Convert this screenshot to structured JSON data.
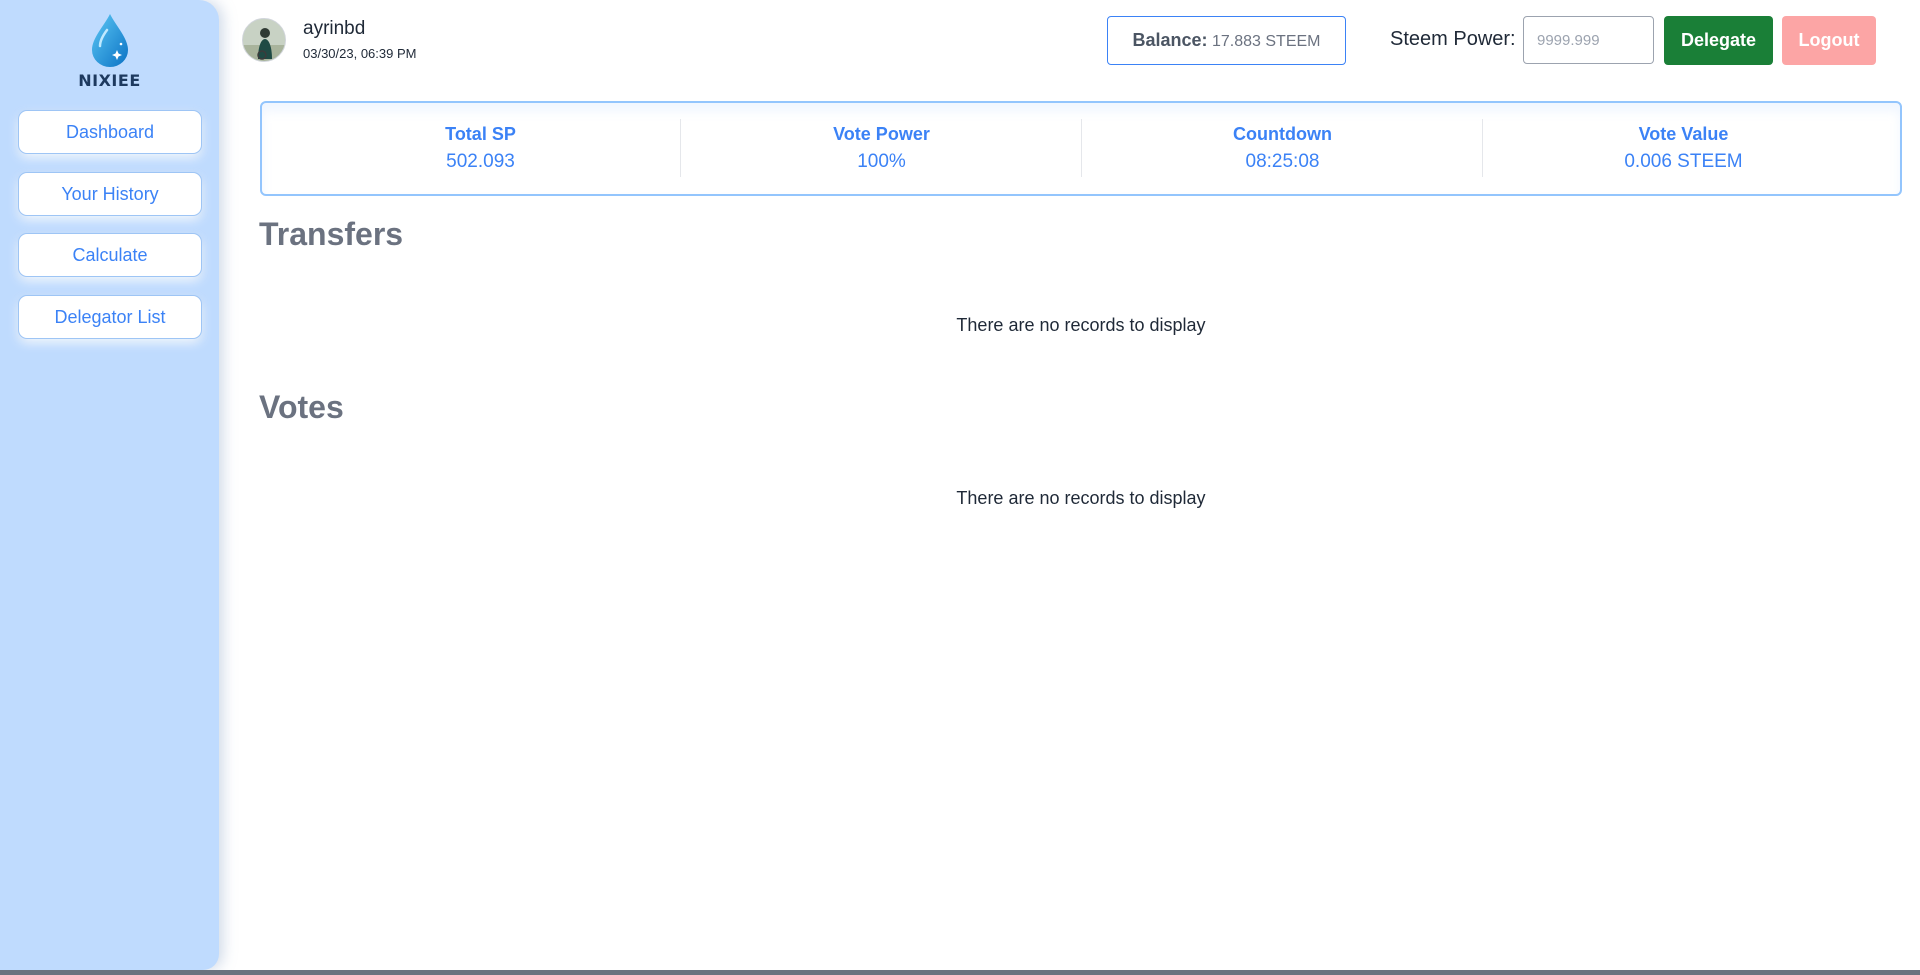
{
  "brand": {
    "name": "NIXIEE",
    "logo_icon": "water-drop-icon",
    "colors": {
      "drop": "#1ea7e8",
      "sidebar": "#bfdbfe",
      "accent": "#3b82f6"
    }
  },
  "sidebar": {
    "items": [
      {
        "label": "Dashboard"
      },
      {
        "label": "Your History"
      },
      {
        "label": "Calculate"
      },
      {
        "label": "Delegator List"
      }
    ]
  },
  "user": {
    "username": "ayrinbd",
    "timestamp": "03/30/23, 06:39 PM",
    "avatar_icon": "user-avatar"
  },
  "header": {
    "balance_label": "Balance:",
    "balance_value": "17.883 STEEM",
    "steem_power_label": "Steem Power:",
    "steem_power_placeholder": "9999.999",
    "delegate_label": "Delegate",
    "logout_label": "Logout",
    "colors": {
      "delegate": "#1a7f37",
      "logout": "#fca5a5"
    }
  },
  "stats": [
    {
      "title": "Total SP",
      "value": "502.093"
    },
    {
      "title": "Vote Power",
      "value": "100%"
    },
    {
      "title": "Countdown",
      "value": "08:25:08"
    },
    {
      "title": "Vote Value",
      "value": "0.006 STEEM"
    }
  ],
  "sections": {
    "transfers": {
      "title": "Transfers",
      "empty_message": "There are no records to display"
    },
    "votes": {
      "title": "Votes",
      "empty_message": "There are no records to display"
    }
  }
}
